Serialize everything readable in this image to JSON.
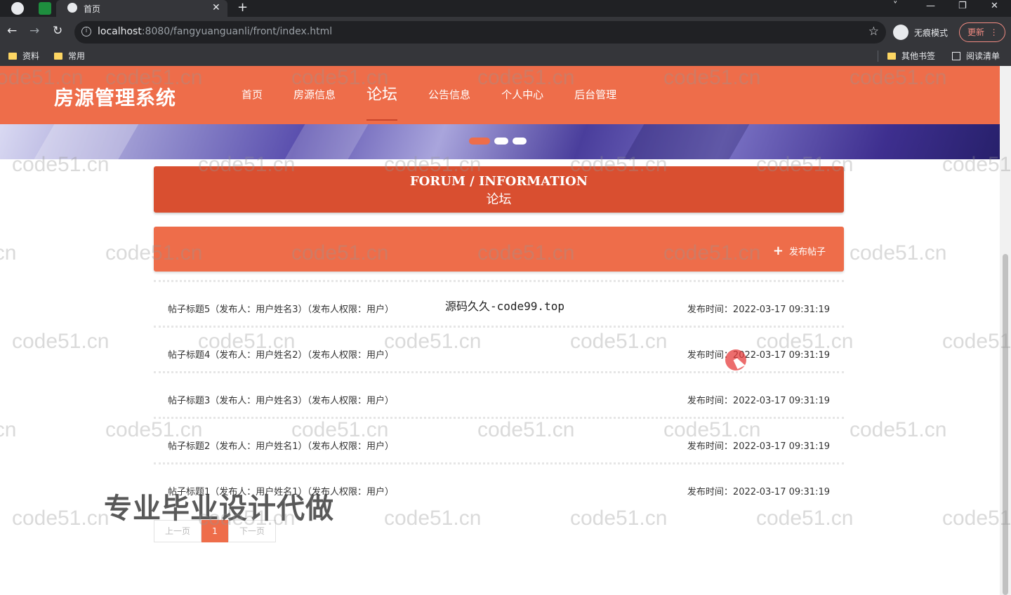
{
  "browser": {
    "tab_title": "首页",
    "new_tab_symbol": "+",
    "close_symbol": "✕",
    "url_host": "localhost",
    "url_path": ":8080/fangyuanguanli/front/index.html",
    "profile_label": "无痕模式",
    "update_label": "更新",
    "bookmarks": [
      "资料",
      "常用"
    ],
    "other_bookmarks": "其他书签",
    "reading_list": "阅读清单",
    "window_controls": [
      "˅",
      "—",
      "❐",
      "✕"
    ]
  },
  "site": {
    "logo": "房源管理系统",
    "nav": [
      "首页",
      "房源信息",
      "论坛",
      "公告信息",
      "个人中心",
      "后台管理"
    ],
    "active_nav_index": 2,
    "accent_color": "#ee6d4a"
  },
  "forum": {
    "title_en": "FORUM / INFORMATION",
    "title_zh": "论坛",
    "post_button_label": "发布帖子",
    "posts": [
      {
        "title": "帖子标题5（发布人：用户姓名3）（发布人权限：用户）",
        "time": "发布时间：2022-03-17 09:31:19"
      },
      {
        "title": "帖子标题4（发布人：用户姓名2）（发布人权限：用户）",
        "time": "发布时间：2022-03-17 09:31:19"
      },
      {
        "title": "帖子标题3（发布人：用户姓名3）（发布人权限：用户）",
        "time": "发布时间：2022-03-17 09:31:19"
      },
      {
        "title": "帖子标题2（发布人：用户姓名1）（发布人权限：用户）",
        "time": "发布时间：2022-03-17 09:31:19"
      },
      {
        "title": "帖子标题1（发布人：用户姓名1）（发布人权限：用户）",
        "time": "发布时间：2022-03-17 09:31:19"
      }
    ]
  },
  "pagination": {
    "prev_label": "上一页",
    "current_page": "1",
    "next_label": "下一页"
  },
  "overlays": {
    "source_text": "源码久久-code99.top",
    "ad_text": "专业毕业设计代做",
    "watermark": "code51.cn"
  }
}
